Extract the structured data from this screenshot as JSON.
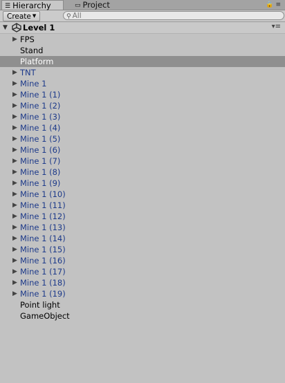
{
  "tabs": [
    {
      "label": "Hierarchy",
      "icon": "list-icon",
      "active": true
    },
    {
      "label": "Project",
      "icon": "folder-icon",
      "active": false
    }
  ],
  "toolbar": {
    "create_label": "Create",
    "search_placeholder": "All"
  },
  "scene": {
    "name": "Level 1",
    "icon": "unity-logo-icon"
  },
  "items": [
    {
      "label": "FPS",
      "expandable": true,
      "prefab": false,
      "selected": false
    },
    {
      "label": "Stand",
      "expandable": false,
      "prefab": false,
      "selected": false
    },
    {
      "label": "Platform",
      "expandable": false,
      "prefab": false,
      "selected": true
    },
    {
      "label": "TNT",
      "expandable": true,
      "prefab": true,
      "selected": false
    },
    {
      "label": "Mine 1",
      "expandable": true,
      "prefab": true,
      "selected": false
    },
    {
      "label": "Mine 1 (1)",
      "expandable": true,
      "prefab": true,
      "selected": false
    },
    {
      "label": "Mine 1 (2)",
      "expandable": true,
      "prefab": true,
      "selected": false
    },
    {
      "label": "Mine 1 (3)",
      "expandable": true,
      "prefab": true,
      "selected": false
    },
    {
      "label": "Mine 1 (4)",
      "expandable": true,
      "prefab": true,
      "selected": false
    },
    {
      "label": "Mine 1 (5)",
      "expandable": true,
      "prefab": true,
      "selected": false
    },
    {
      "label": "Mine 1 (6)",
      "expandable": true,
      "prefab": true,
      "selected": false
    },
    {
      "label": "Mine 1 (7)",
      "expandable": true,
      "prefab": true,
      "selected": false
    },
    {
      "label": "Mine 1 (8)",
      "expandable": true,
      "prefab": true,
      "selected": false
    },
    {
      "label": "Mine 1 (9)",
      "expandable": true,
      "prefab": true,
      "selected": false
    },
    {
      "label": "Mine 1 (10)",
      "expandable": true,
      "prefab": true,
      "selected": false
    },
    {
      "label": "Mine 1 (11)",
      "expandable": true,
      "prefab": true,
      "selected": false
    },
    {
      "label": "Mine 1 (12)",
      "expandable": true,
      "prefab": true,
      "selected": false
    },
    {
      "label": "Mine 1 (13)",
      "expandable": true,
      "prefab": true,
      "selected": false
    },
    {
      "label": "Mine 1 (14)",
      "expandable": true,
      "prefab": true,
      "selected": false
    },
    {
      "label": "Mine 1 (15)",
      "expandable": true,
      "prefab": true,
      "selected": false
    },
    {
      "label": "Mine 1 (16)",
      "expandable": true,
      "prefab": true,
      "selected": false
    },
    {
      "label": "Mine 1 (17)",
      "expandable": true,
      "prefab": true,
      "selected": false
    },
    {
      "label": "Mine 1 (18)",
      "expandable": true,
      "prefab": true,
      "selected": false
    },
    {
      "label": "Mine 1 (19)",
      "expandable": true,
      "prefab": true,
      "selected": false
    },
    {
      "label": "Point light",
      "expandable": false,
      "prefab": false,
      "selected": false
    },
    {
      "label": "GameObject",
      "expandable": false,
      "prefab": false,
      "selected": false
    }
  ],
  "colors": {
    "panel_bg": "#c2c2c2",
    "prefab_text": "#1d3a8a",
    "selection_bg": "#8f8f8f"
  }
}
